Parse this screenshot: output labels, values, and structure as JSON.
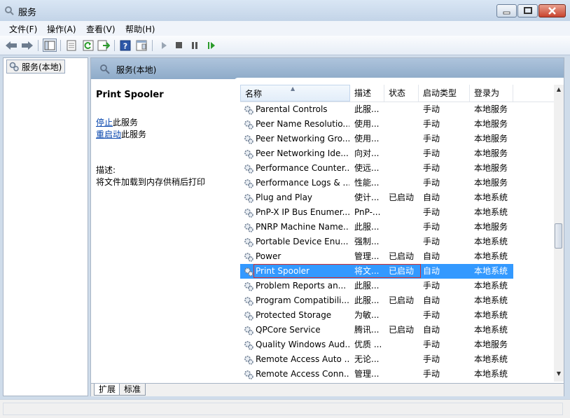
{
  "window": {
    "title": "服务"
  },
  "menu": [
    "文件(F)",
    "操作(A)",
    "查看(V)",
    "帮助(H)"
  ],
  "toolbar": {
    "icons": [
      "back-arrow-icon",
      "forward-arrow-icon",
      "console-tree-icon",
      "properties-icon",
      "refresh-icon",
      "export-list-icon",
      "help-icon",
      "show-hide-icon",
      "play-icon",
      "stop-icon",
      "pause-icon",
      "resume-icon"
    ]
  },
  "tree": {
    "root_label": "服务(本地)"
  },
  "pane": {
    "header": "服务(本地)",
    "detail": {
      "title": "Print Spooler",
      "stop_link": "停止",
      "stop_suffix": "此服务",
      "restart_link": "重启动",
      "restart_suffix": "此服务",
      "desc_label": "描述:",
      "desc_text": "将文件加载到内存供稍后打印"
    }
  },
  "columns": {
    "name": "名称",
    "desc": "描述",
    "status": "状态",
    "start": "启动类型",
    "logon": "登录为"
  },
  "rows": [
    {
      "name": "Parental Controls",
      "desc": "此服...",
      "status": "",
      "start": "手动",
      "logon": "本地服务"
    },
    {
      "name": "Peer Name Resolutio...",
      "desc": "使用...",
      "status": "",
      "start": "手动",
      "logon": "本地服务"
    },
    {
      "name": "Peer Networking Gro...",
      "desc": "使用...",
      "status": "",
      "start": "手动",
      "logon": "本地服务"
    },
    {
      "name": "Peer Networking Ide...",
      "desc": "向对...",
      "status": "",
      "start": "手动",
      "logon": "本地服务"
    },
    {
      "name": "Performance Counter...",
      "desc": "使远...",
      "status": "",
      "start": "手动",
      "logon": "本地服务"
    },
    {
      "name": "Performance Logs & ...",
      "desc": "性能...",
      "status": "",
      "start": "手动",
      "logon": "本地服务"
    },
    {
      "name": "Plug and Play",
      "desc": "使计...",
      "status": "已启动",
      "start": "自动",
      "logon": "本地系统"
    },
    {
      "name": "PnP-X IP Bus Enumer...",
      "desc": "PnP-...",
      "status": "",
      "start": "手动",
      "logon": "本地系统"
    },
    {
      "name": "PNRP Machine Name...",
      "desc": "此服...",
      "status": "",
      "start": "手动",
      "logon": "本地服务"
    },
    {
      "name": "Portable Device Enu...",
      "desc": "强制...",
      "status": "",
      "start": "手动",
      "logon": "本地系统"
    },
    {
      "name": "Power",
      "desc": "管理...",
      "status": "已启动",
      "start": "自动",
      "logon": "本地系统"
    },
    {
      "name": "Print Spooler",
      "desc": "将文...",
      "status": "已启动",
      "start": "自动",
      "logon": "本地系统",
      "selected": true
    },
    {
      "name": "Problem Reports an...",
      "desc": "此服...",
      "status": "",
      "start": "手动",
      "logon": "本地系统"
    },
    {
      "name": "Program Compatibili...",
      "desc": "此服...",
      "status": "已启动",
      "start": "自动",
      "logon": "本地系统"
    },
    {
      "name": "Protected Storage",
      "desc": "为敏...",
      "status": "",
      "start": "手动",
      "logon": "本地系统"
    },
    {
      "name": "QPCore Service",
      "desc": "腾讯...",
      "status": "已启动",
      "start": "自动",
      "logon": "本地系统"
    },
    {
      "name": "Quality Windows Aud...",
      "desc": "优质 ...",
      "status": "",
      "start": "手动",
      "logon": "本地服务"
    },
    {
      "name": "Remote Access Auto ...",
      "desc": "无论...",
      "status": "",
      "start": "手动",
      "logon": "本地系统"
    },
    {
      "name": "Remote Access Conn...",
      "desc": "管理...",
      "status": "",
      "start": "手动",
      "logon": "本地系统"
    }
  ],
  "tabs": {
    "extended": "扩展",
    "standard": "标准"
  }
}
